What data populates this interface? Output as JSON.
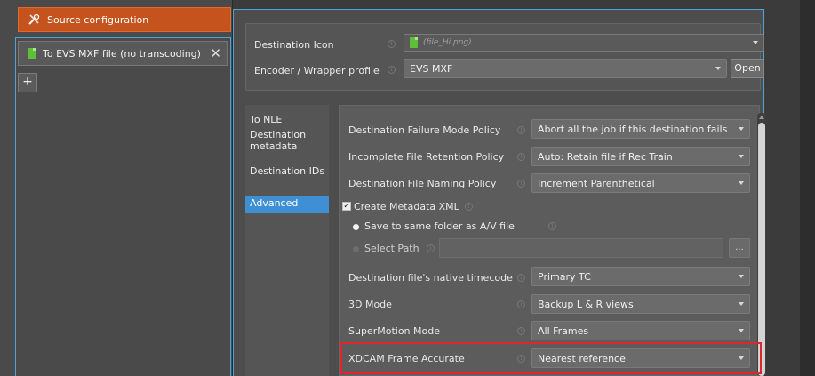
{
  "left": {
    "source_config_label": "Source configuration",
    "destination_label": "To EVS MXF file (no transcoding)",
    "close_symbol": "✕",
    "add_symbol": "+"
  },
  "top": {
    "dest_icon_label": "Destination Icon",
    "dest_icon_value": "(file_Hi.png)",
    "encoder_label": "Encoder / Wrapper profile",
    "encoder_value": "EVS MXF",
    "open_label": "Open"
  },
  "nav": {
    "items": [
      "To NLE",
      "Destination metadata",
      "Destination IDs",
      "Advanced"
    ],
    "active": "Advanced"
  },
  "advanced": {
    "failure_label": "Destination Failure Mode Policy",
    "failure_value": "Abort all the job if this destination fails",
    "incomplete_label": "Incomplete File Retention Policy",
    "incomplete_value": "Auto: Retain file if Rec Train",
    "naming_label": "Destination File Naming Policy",
    "naming_value": "Increment Parenthetical",
    "create_xml_label": "Create Metadata XML",
    "create_xml_checked": true,
    "same_folder_label": "Save to same folder as A/V file",
    "select_path_label": "Select Path",
    "path_value": "",
    "browse_label": "...",
    "timecode_label": "Destination file's native timecode",
    "timecode_value": "Primary TC",
    "mode3d_label": "3D Mode",
    "mode3d_value": "Backup L & R views",
    "supermotion_label": "SuperMotion Mode",
    "supermotion_value": "All Frames",
    "xdcam_label": "XDCAM Frame Accurate",
    "xdcam_value": "Nearest reference"
  },
  "colors": {
    "accent_orange": "#c4531d",
    "selection_blue": "#3f8fd4",
    "focus_border": "#4fa6d6",
    "highlight_red": "#e0262b",
    "file_green": "#5fbf3a"
  },
  "icons": {
    "source": "tools-icon",
    "file": "green-file-icon",
    "info": "info-icon",
    "dropdown": "chevron-down-icon"
  }
}
